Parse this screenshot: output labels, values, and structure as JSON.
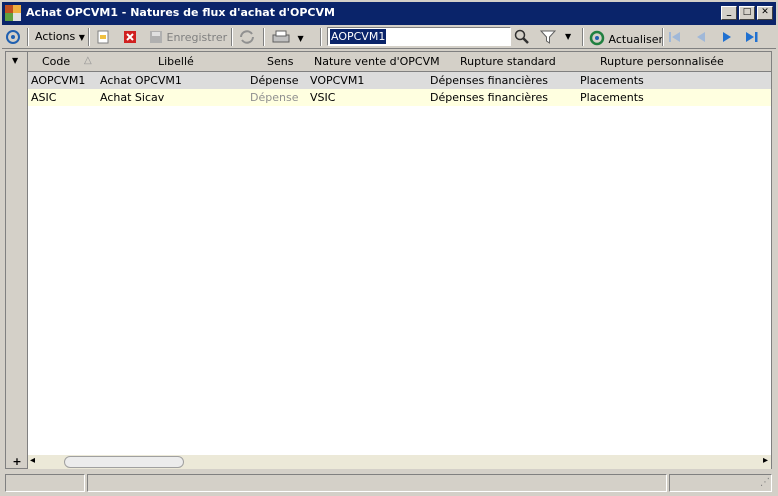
{
  "window": {
    "title": "Achat OPCVM1 - Natures de flux d'achat d'OPCVM",
    "minimize": "_",
    "maximize": "□",
    "close": "✕"
  },
  "toolbar": {
    "actions_label": "Actions",
    "save_label": "Enregistrer",
    "search_value": "AOPCVM1",
    "refresh_label": "Actualiser"
  },
  "grid": {
    "columns": [
      "Code",
      "Libellé",
      "Sens",
      "Nature vente d'OPCVM",
      "Rupture standard",
      "Rupture personnalisée"
    ],
    "rows": [
      [
        "AOPCVM1",
        "Achat OPCVM1",
        "Dépense",
        "VOPCVM1",
        "Dépenses financières",
        "Placements"
      ],
      [
        "ASIC",
        "Achat Sicav",
        "Dépense",
        "VSIC",
        "Dépenses financières",
        "Placements"
      ]
    ],
    "add_row": "+",
    "scroll_left": "◂",
    "scroll_right": "▸"
  }
}
